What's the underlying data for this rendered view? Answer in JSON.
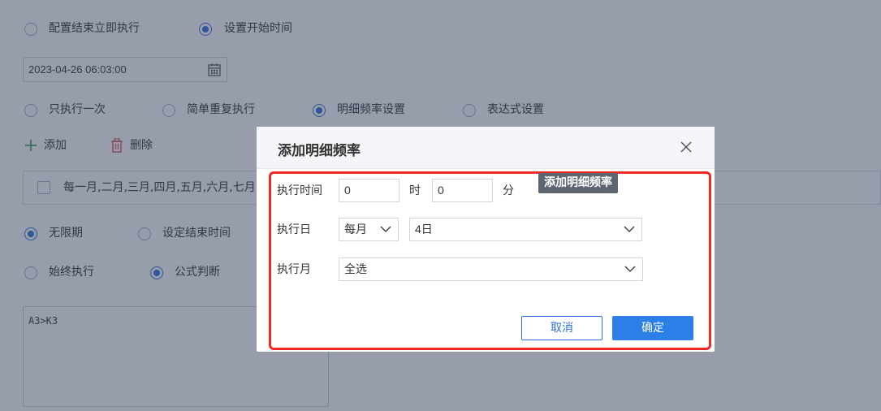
{
  "background": {
    "end_mode": {
      "option_immediate": "配置结束立即执行",
      "option_start_time": "设置开始时间",
      "selected": "option_start_time"
    },
    "start_datetime": "2023-04-26 06:03:00",
    "frequency": {
      "option_once": "只执行一次",
      "option_simple": "简单重复执行",
      "option_detail": "明细频率设置",
      "option_expression": "表达式设置",
      "selected": "option_detail"
    },
    "toolbar": {
      "add_label": "添加",
      "delete_label": "删除"
    },
    "list_row_text": "每一月,二月,三月,四月,五月,六月,七月",
    "period": {
      "option_unlimited": "无限期",
      "option_set_end": "设定结束时间",
      "selected": "option_unlimited"
    },
    "exec_condition": {
      "option_always": "始终执行",
      "option_formula": "公式判断",
      "selected": "option_formula"
    },
    "formula_value": "A3>K3"
  },
  "dialog": {
    "title": "添加明细频率",
    "tooltip": "添加明细频率",
    "exec_time": {
      "label": "执行时间",
      "hour_value": "0",
      "hour_unit": "时",
      "minute_value": "0",
      "minute_unit": "分"
    },
    "exec_day": {
      "label": "执行日",
      "period_value": "每月",
      "day_value": "4日"
    },
    "exec_month": {
      "label": "执行月",
      "value": "全选"
    },
    "cancel_label": "取消",
    "ok_label": "确定"
  },
  "colors": {
    "accent": "#2d7fe8",
    "highlight_frame": "#ee2a24",
    "tooltip_bg": "#5e6470"
  }
}
